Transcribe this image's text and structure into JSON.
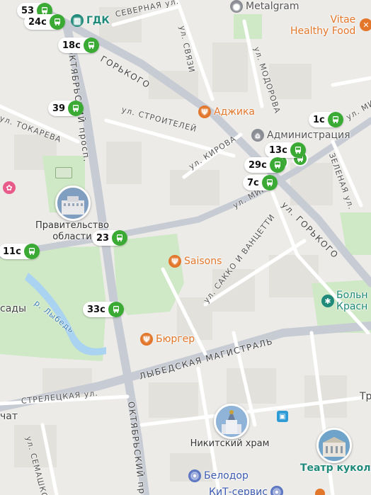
{
  "streets": {
    "severnaya": "СЕВЕРНАЯ ул.",
    "svyazi": "ул. СВЯЗИ",
    "gorkogo_top": "ГОРЬКОГО",
    "modorova": "ул. МОДОРОВА",
    "stroiteley": "ул. СТРОИТЕЛЕЙ",
    "tokareva": "ул. ТОКАРЕВА",
    "kirova": "ул. КИРОВА",
    "oktyabrsky_top": "ОКТЯБРЬСКИЙ просп.",
    "zelenaya": "ЗЕЛЕНАЯ ул.",
    "gorkogo_bottom": "ул. ГОРЬКОГО",
    "mira_center": "ул. МИРА",
    "mira_right": "ул. МИРА",
    "sakko": "ул. САККО И ВАНЦЕТТИ",
    "lybed_river": "р. Лыбедь",
    "lybedskaya": "ЛЫБЕДСКАЯ МАГИСТРАЛЬ",
    "streletskaya": "СТРЕЛЕЦКАЯ ул.",
    "semashko": "ул. СЕМАШКО",
    "oktyabrsky_bottom": "ОКТЯБРЬСКИЙ просп."
  },
  "stops": [
    {
      "id": "53",
      "route": "53"
    },
    {
      "id": "24c",
      "route": "24с"
    },
    {
      "id": "18c",
      "route": "18с"
    },
    {
      "id": "39",
      "route": "39"
    },
    {
      "id": "1c",
      "route": "1с"
    },
    {
      "id": "13c",
      "route": "13с"
    },
    {
      "id": "29c",
      "route": "29с"
    },
    {
      "id": "7c",
      "route": "7с"
    },
    {
      "id": "23",
      "route": "23"
    },
    {
      "id": "11c",
      "route": "11с"
    },
    {
      "id": "33c",
      "route": "33с"
    }
  ],
  "pois": {
    "gdk": "ГДК",
    "metalgram": "Metalgram",
    "vitae_line1": "Vitae",
    "vitae_line2": "Healthy Food",
    "adzhika": "Аджика",
    "administration": "Администрация",
    "government_line1": "Правительство",
    "government_line2": "области",
    "saisons": "Saisons",
    "sady": "сады",
    "hospital_line1": "Больн",
    "hospital_line2": "Красн",
    "burger": "Бюргер",
    "nikitsky": "Никитский храм",
    "belodor": "Белодор",
    "puppet_theater": "Театр кукол",
    "kit_service": "КиТ-сервис",
    "chat_partial": "чат",
    "tr_partial": "Тр"
  },
  "colors": {
    "bus_green": "#3aaa35",
    "food_orange": "#e2762a",
    "park_green": "#cfe8c6",
    "river_blue": "#a9d3f0",
    "road_major": "#c7cbd3",
    "road_minor": "#ffffff"
  }
}
